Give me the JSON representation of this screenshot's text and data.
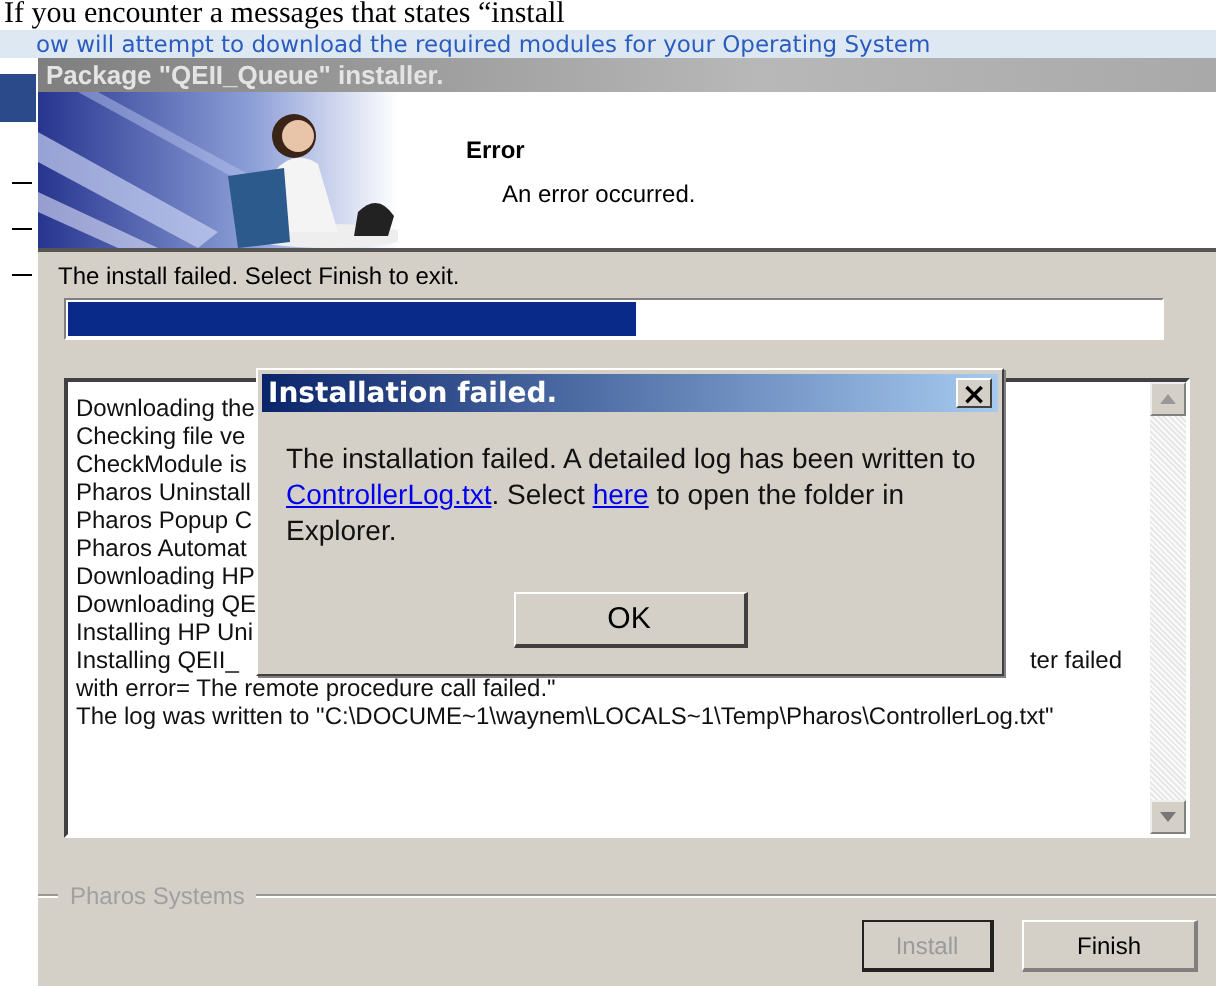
{
  "page": {
    "heading": "If you encounter a messages that states “install",
    "intro": "ow will attempt to download the required modules for your Operating System"
  },
  "window": {
    "title": "Package \"QEII_Queue\" installer.",
    "header": {
      "title": "Error",
      "subtitle": "An error occurred."
    },
    "status": "The install failed. Select Finish to exit.",
    "progress": {
      "level": 0.52
    },
    "log": [
      {
        "text": "Downloading the"
      },
      {
        "text": "Checking file ve"
      },
      {
        "text": "CheckModule is"
      },
      {
        "text": "Pharos Uninstall"
      },
      {
        "text": "Pharos Popup C"
      },
      {
        "text": "Pharos Automat"
      },
      {
        "text": "Downloading HP"
      },
      {
        "text": "Downloading QE"
      },
      {
        "text": "Installing HP Uni"
      },
      {
        "text": "Installing QEII_",
        "tail": "ter failed"
      },
      {
        "text": "with error= The remote procedure call failed.\""
      },
      {
        "text": "The log was written to \"C:\\DOCUME~1\\waynem\\LOCALS~1\\Temp\\Pharos\\ControllerLog.txt\""
      }
    ],
    "group_label": "Pharos Systems",
    "buttons": [
      {
        "label": "Install",
        "disabled": true
      },
      {
        "label": "Finish",
        "disabled": false
      }
    ]
  },
  "dialog": {
    "title": "Installation failed.",
    "close": "×",
    "message": {
      "before": "The installation failed. A detailed log has been written to ",
      "link1": "ControllerLog.txt",
      "middle": ". Select ",
      "link2": "here",
      "after": " to open the folder in Explorer."
    },
    "ok": "OK"
  }
}
